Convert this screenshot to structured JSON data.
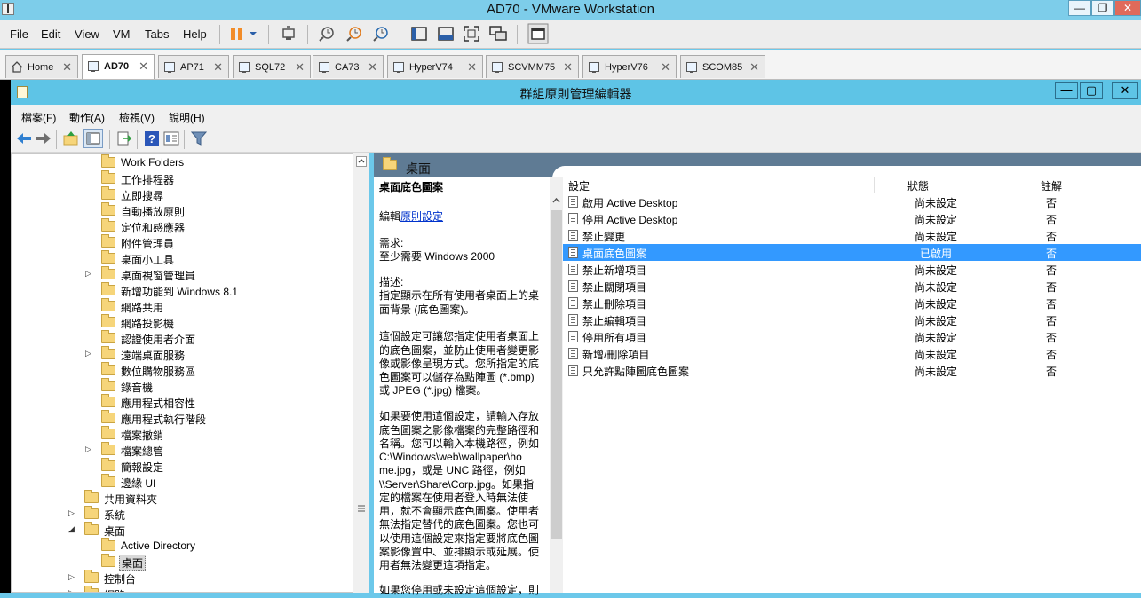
{
  "vmware": {
    "title": "AD70 - VMware Workstation",
    "menus": [
      "File",
      "Edit",
      "View",
      "VM",
      "Tabs",
      "Help"
    ],
    "window_controls": {
      "minimize": "—",
      "restore": "❐",
      "close": "✕"
    },
    "tabs": [
      {
        "label": "Home",
        "icon": "home-icon",
        "active": false
      },
      {
        "label": "AD70",
        "icon": "vm-icon",
        "active": true
      },
      {
        "label": "AP71",
        "icon": "vm-icon",
        "active": false
      },
      {
        "label": "SQL72",
        "icon": "vm-icon",
        "active": false
      },
      {
        "label": "CA73",
        "icon": "vm-icon",
        "active": false
      },
      {
        "label": "HyperV74",
        "icon": "vm-icon",
        "active": false
      },
      {
        "label": "SCVMM75",
        "icon": "vm-icon",
        "active": false
      },
      {
        "label": "HyperV76",
        "icon": "vm-icon",
        "active": false
      },
      {
        "label": "SCOM85",
        "icon": "vm-icon",
        "active": false
      }
    ],
    "tab_close": "✕",
    "colors": {
      "titlebar": "#7dcdea",
      "pause_icon": "#f28c28"
    }
  },
  "gpedit": {
    "title": "群組原則管理編輯器",
    "window_controls": {
      "minimize": "—",
      "restore": "▢",
      "close": "✕"
    },
    "menus": [
      "檔案(F)",
      "動作(A)",
      "檢視(V)",
      "說明(H)"
    ],
    "tree": [
      {
        "label": "Work Folders",
        "expander": ""
      },
      {
        "label": "工作排程器",
        "expander": ""
      },
      {
        "label": "立即搜尋",
        "expander": ""
      },
      {
        "label": "自動播放原則",
        "expander": ""
      },
      {
        "label": "定位和感應器",
        "expander": ""
      },
      {
        "label": "附件管理員",
        "expander": ""
      },
      {
        "label": "桌面小工具",
        "expander": ""
      },
      {
        "label": "桌面視窗管理員",
        "expander": "▷"
      },
      {
        "label": "新增功能到 Windows 8.1",
        "expander": ""
      },
      {
        "label": "網路共用",
        "expander": ""
      },
      {
        "label": "網路投影機",
        "expander": ""
      },
      {
        "label": "認證使用者介面",
        "expander": ""
      },
      {
        "label": "遠端桌面服務",
        "expander": "▷"
      },
      {
        "label": "數位購物服務區",
        "expander": ""
      },
      {
        "label": "錄音機",
        "expander": ""
      },
      {
        "label": "應用程式相容性",
        "expander": ""
      },
      {
        "label": "應用程式執行階段",
        "expander": ""
      },
      {
        "label": "檔案撤銷",
        "expander": ""
      },
      {
        "label": "檔案總管",
        "expander": "▷"
      },
      {
        "label": "簡報設定",
        "expander": ""
      },
      {
        "label": "邊緣 UI",
        "expander": ""
      },
      {
        "label": "共用資料夾",
        "expander": ""
      },
      {
        "label": "系統",
        "expander": "▷"
      },
      {
        "label": "桌面",
        "expander": "◢"
      },
      {
        "label": "Active Directory",
        "expander": ""
      },
      {
        "label": "桌面",
        "expander": "",
        "selected": true
      },
      {
        "label": "控制台",
        "expander": "▷"
      },
      {
        "label": "網路",
        "expander": "▷"
      }
    ],
    "pane_header": "桌面",
    "description": {
      "lines": [
        "桌面底色圖案",
        "",
        "編輯原則設定",
        "",
        "需求:",
        "至少需要 Windows 2000",
        "",
        "描述:",
        "指定顯示在所有使用者桌面上的桌",
        "面背景 (底色圖案)。",
        "",
        "這個設定可讓您指定使用者桌面上",
        "的底色圖案，並防止使用者變更影",
        "像或影像呈現方式。您所指定的底",
        "色圖案可以儲存為點陣圖 (*.bmp)",
        "或 JPEG (*.jpg) 檔案。",
        "",
        "如果要使用這個設定，請輸入存放",
        "底色圖案之影像檔案的完整路徑和",
        "名稱。您可以輸入本機路徑，例如",
        "C:\\Windows\\web\\wallpaper\\ho",
        "me.jpg，或是 UNC 路徑，例如",
        "\\\\Server\\Share\\Corp.jpg。如果指",
        "定的檔案在使用者登入時無法使",
        "用，就不會顯示底色圖案。使用者",
        "無法指定替代的底色圖案。您也可",
        "以使用這個設定來指定要將底色圖",
        "案影像置中、並排顯示或延展。使",
        "用者無法變更這項指定。",
        "",
        "如果您停用或未設定這個設定，則"
      ],
      "edit_prefix": "編輯",
      "edit_link": "原則設定"
    },
    "list": {
      "columns": {
        "setting": "設定",
        "state": "狀態",
        "comment": "註解"
      },
      "rows": [
        {
          "name": "啟用 Active Desktop",
          "state": "尚未設定",
          "comment": "否"
        },
        {
          "name": "停用 Active Desktop",
          "state": "尚未設定",
          "comment": "否"
        },
        {
          "name": "禁止變更",
          "state": "尚未設定",
          "comment": "否"
        },
        {
          "name": "桌面底色圖案",
          "state": "已啟用",
          "comment": "否",
          "selected": true
        },
        {
          "name": "禁止新增項目",
          "state": "尚未設定",
          "comment": "否"
        },
        {
          "name": "禁止關閉項目",
          "state": "尚未設定",
          "comment": "否"
        },
        {
          "name": "禁止刪除項目",
          "state": "尚未設定",
          "comment": "否"
        },
        {
          "name": "禁止編輯項目",
          "state": "尚未設定",
          "comment": "否"
        },
        {
          "name": "停用所有項目",
          "state": "尚未設定",
          "comment": "否"
        },
        {
          "name": "新增/刪除項目",
          "state": "尚未設定",
          "comment": "否"
        },
        {
          "name": "只允許點陣圖底色圖案",
          "state": "尚未設定",
          "comment": "否"
        }
      ]
    },
    "colors": {
      "titlebar": "#5ec4e6",
      "pane_header": "#5f7b94",
      "selection": "#3399ff",
      "link": "#0033cc"
    }
  }
}
